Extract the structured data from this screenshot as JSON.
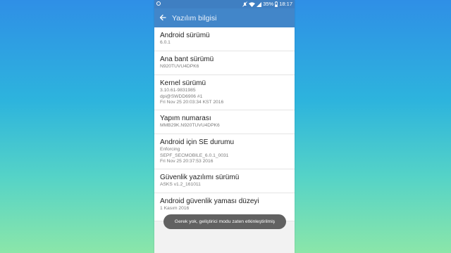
{
  "status_bar": {
    "battery": "35%",
    "time": "18:17",
    "icons": [
      "notification-circle-icon",
      "silent-icon",
      "wifi-icon",
      "signal-icon",
      "battery-icon"
    ]
  },
  "app_bar": {
    "title": "Yazılım bilgisi",
    "back_icon": "arrow-left-icon"
  },
  "items": [
    {
      "title": "Android sürümü",
      "lines": [
        "6.0.1"
      ]
    },
    {
      "title": "Ana bant sürümü",
      "lines": [
        "N920TUVU4DPK6"
      ]
    },
    {
      "title": "Kernel sürümü",
      "lines": [
        "3.10.61-9831985",
        "dpi@SWDD6906 #1",
        "Fri Nov 25 20:03:34 KST 2016"
      ]
    },
    {
      "title": "Yapım numarası",
      "lines": [
        "MMB29K.N920TUVU4DPK6"
      ]
    },
    {
      "title": "Android için SE durumu",
      "lines": [
        "Enforcing",
        "SEPF_SECMOBILE_6.0.1_0031",
        "Fri Nov 25 20:37:53 2016"
      ]
    },
    {
      "title": "Güvenlik yazılımı sürümü",
      "lines": [
        "ASKS v1.2_161011"
      ]
    },
    {
      "title": "Android güvenlik yaması düzeyi",
      "lines": [
        "1 Kasım 2016"
      ]
    }
  ],
  "toast": {
    "text": "Gerek yok, geliştirici modu zaten etkinleştirilmiş"
  },
  "colors": {
    "status_bar": "#3f7fc2",
    "app_bar": "#4286c9",
    "toast": "#616161"
  }
}
